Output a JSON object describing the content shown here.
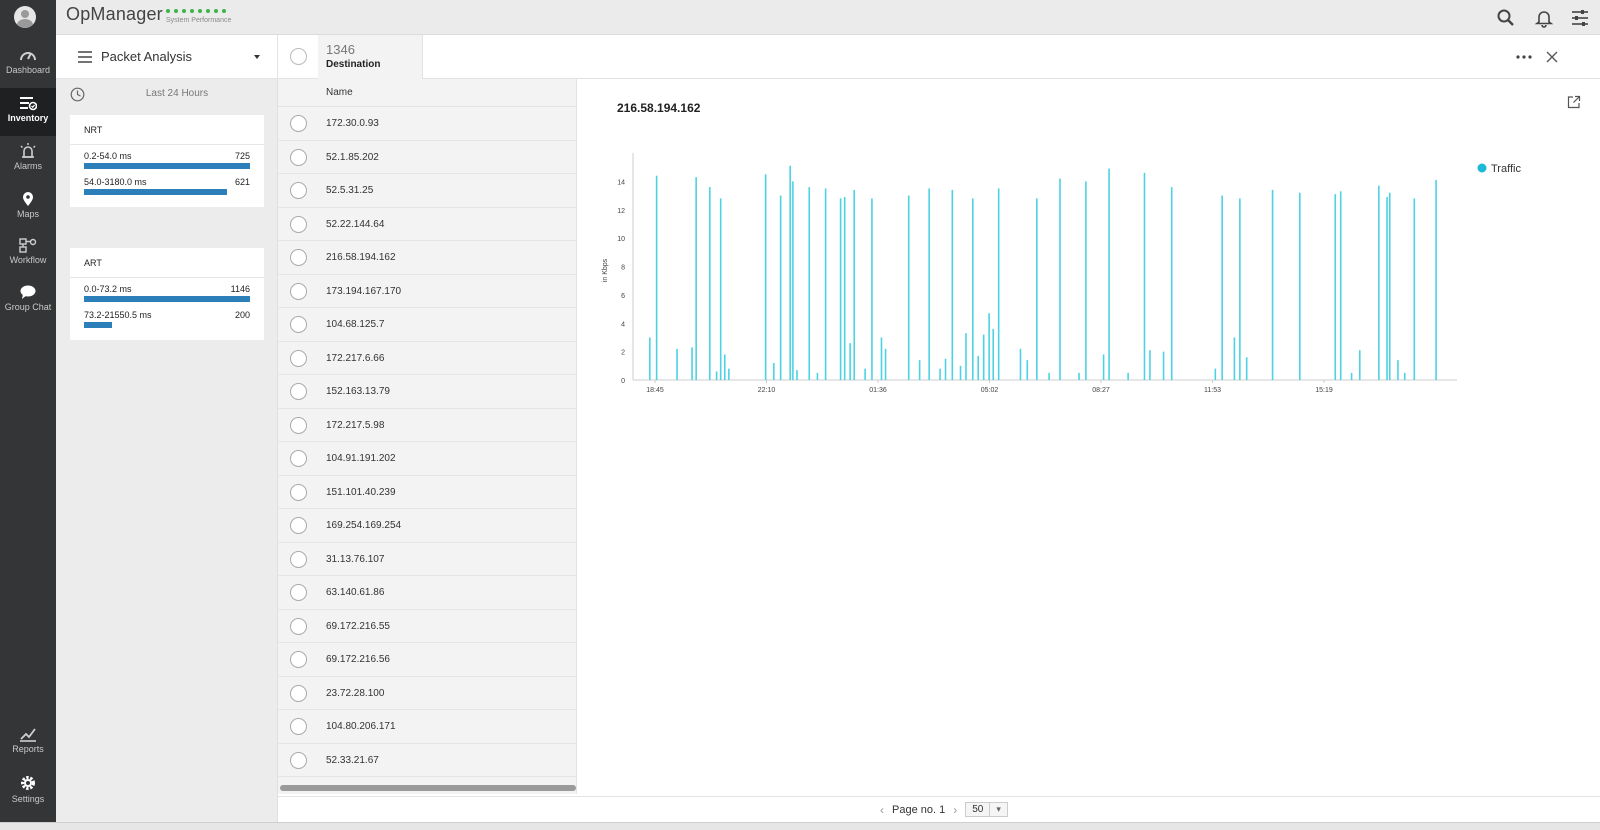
{
  "app": {
    "title": "OpManager",
    "perf_label": "System Performance",
    "perf_color": "#3bb54a"
  },
  "nav": {
    "items": [
      {
        "label": "Dashboard",
        "icon": "dashboard-icon"
      },
      {
        "label": "Inventory",
        "icon": "inventory-icon"
      },
      {
        "label": "Alarms",
        "icon": "alarm-icon"
      },
      {
        "label": "Maps",
        "icon": "map-pin-icon"
      },
      {
        "label": "Workflow",
        "icon": "workflow-icon"
      },
      {
        "label": "Group Chat",
        "icon": "chat-icon"
      }
    ],
    "bottom": [
      {
        "label": "Reports",
        "icon": "reports-icon"
      },
      {
        "label": "Settings",
        "icon": "gear-icon"
      }
    ],
    "active": "Inventory"
  },
  "header": {
    "module_label": "Packet Analysis",
    "destination_count": "1346",
    "destination_label": "Destination"
  },
  "filters": {
    "time_range": "Last 24 Hours",
    "nrt": {
      "title": "NRT",
      "rows": [
        {
          "range": "0.2-54.0 ms",
          "count": "725",
          "fraction": 1.0
        },
        {
          "range": "54.0-3180.0 ms",
          "count": "621",
          "fraction": 0.86
        }
      ]
    },
    "art": {
      "title": "ART",
      "rows": [
        {
          "range": "0.0-73.2 ms",
          "count": "1146",
          "fraction": 1.0
        },
        {
          "range": "73.2-21550.5 ms",
          "count": "200",
          "fraction": 0.17
        }
      ]
    }
  },
  "list": {
    "column": "Name",
    "rows": [
      "172.30.0.93",
      "52.1.85.202",
      "52.5.31.25",
      "52.22.144.64",
      "216.58.194.162",
      "173.194.167.170",
      "104.68.125.7",
      "172.217.6.66",
      "152.163.13.79",
      "172.217.5.98",
      "104.91.191.202",
      "151.101.40.239",
      "169.254.169.254",
      "31.13.76.107",
      "63.140.61.86",
      "69.172.216.55",
      "69.172.216.56",
      "23.72.28.100",
      "104.80.206.171",
      "52.33.21.67"
    ]
  },
  "chart": {
    "title": "216.58.194.162"
  },
  "chart_data": {
    "type": "area",
    "title": "216.58.194.162",
    "ylabel": "in Kbps",
    "xlabel": "",
    "ylim": [
      0,
      16
    ],
    "yticks": [
      0,
      2,
      4,
      6,
      8,
      10,
      12,
      14
    ],
    "xtick_labels": [
      "18:45",
      "22:10",
      "01:36",
      "05:02",
      "08:27",
      "11:53",
      "15:19"
    ],
    "legend": "top-right",
    "grid": false,
    "series": [
      {
        "name": "Traffic",
        "color": "#4dd2e3",
        "spikes": [
          [
            0.5,
            3.0
          ],
          [
            1.0,
            14.4
          ],
          [
            2.5,
            2.2
          ],
          [
            3.6,
            2.3
          ],
          [
            3.9,
            14.3
          ],
          [
            4.9,
            13.6
          ],
          [
            5.4,
            0.6
          ],
          [
            5.7,
            12.8
          ],
          [
            6.0,
            1.8
          ],
          [
            6.3,
            0.8
          ],
          [
            9.0,
            14.5
          ],
          [
            9.6,
            1.2
          ],
          [
            10.1,
            13.0
          ],
          [
            10.8,
            15.1
          ],
          [
            11.0,
            14.0
          ],
          [
            11.3,
            0.7
          ],
          [
            12.2,
            13.6
          ],
          [
            12.8,
            0.5
          ],
          [
            13.4,
            13.5
          ],
          [
            14.5,
            12.8
          ],
          [
            14.8,
            12.9
          ],
          [
            15.2,
            2.6
          ],
          [
            15.5,
            13.4
          ],
          [
            16.3,
            0.8
          ],
          [
            16.8,
            12.8
          ],
          [
            17.5,
            3.0
          ],
          [
            17.8,
            2.2
          ],
          [
            19.5,
            13.0
          ],
          [
            20.3,
            1.4
          ],
          [
            21.0,
            13.5
          ],
          [
            21.8,
            0.8
          ],
          [
            22.2,
            1.5
          ],
          [
            22.7,
            13.4
          ],
          [
            23.3,
            1.0
          ],
          [
            23.7,
            3.3
          ],
          [
            24.2,
            12.8
          ],
          [
            24.6,
            1.7
          ],
          [
            25.0,
            3.2
          ],
          [
            25.4,
            4.7
          ],
          [
            25.7,
            3.6
          ],
          [
            26.1,
            13.5
          ],
          [
            27.7,
            2.2
          ],
          [
            28.2,
            1.4
          ],
          [
            28.9,
            12.8
          ],
          [
            29.8,
            0.5
          ],
          [
            30.6,
            14.2
          ],
          [
            32.0,
            0.5
          ],
          [
            32.5,
            14.0
          ],
          [
            33.8,
            1.8
          ],
          [
            34.2,
            14.9
          ],
          [
            35.6,
            0.5
          ],
          [
            36.8,
            14.6
          ],
          [
            37.2,
            2.1
          ],
          [
            38.2,
            2.0
          ],
          [
            38.8,
            13.6
          ],
          [
            42.0,
            0.8
          ],
          [
            42.5,
            13.0
          ],
          [
            43.4,
            3.0
          ],
          [
            43.8,
            12.8
          ],
          [
            44.3,
            1.6
          ],
          [
            46.2,
            13.4
          ],
          [
            48.2,
            13.2
          ],
          [
            50.8,
            13.1
          ],
          [
            51.2,
            13.3
          ],
          [
            52.0,
            0.5
          ],
          [
            52.6,
            2.1
          ],
          [
            54.0,
            13.7
          ],
          [
            54.6,
            12.9
          ],
          [
            54.8,
            13.2
          ],
          [
            55.4,
            1.4
          ],
          [
            55.9,
            0.5
          ],
          [
            56.6,
            12.8
          ],
          [
            58.2,
            14.1
          ]
        ]
      }
    ]
  },
  "pagination": {
    "label": "Page no. 1",
    "page_size": "50",
    "prev": "‹",
    "next": "›",
    "size_caret": "▾"
  }
}
